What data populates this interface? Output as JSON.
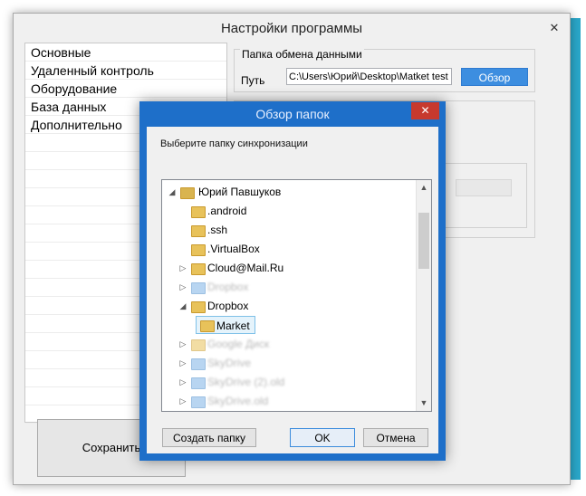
{
  "window": {
    "title": "Настройки программы",
    "close_glyph": "✕"
  },
  "menu": {
    "items": [
      "Основные",
      "Удаленный контроль",
      "Оборудование",
      "База данных",
      "Дополнительно"
    ]
  },
  "exchange": {
    "legend": "Папка обмена данными",
    "path_label": "Путь",
    "path_value": "C:\\Users\\Юрий\\Desktop\\Matket test",
    "browse_label": "Обзор"
  },
  "save_label": "Сохранить",
  "dialog": {
    "title": "Обзор папок",
    "close_glyph": "✕",
    "prompt": "Выберите папку синхронизации",
    "tree": [
      {
        "label": "Юрий Павшуков",
        "state": "expanded"
      },
      {
        "label": ".android"
      },
      {
        "label": ".ssh"
      },
      {
        "label": ".VirtualBox"
      },
      {
        "label": "Cloud@Mail.Ru",
        "state": "collapsed"
      },
      {
        "label": "Dropbox",
        "state": "collapsed",
        "obscured": true
      },
      {
        "label": "Dropbox",
        "state": "expanded"
      },
      {
        "label": "Market",
        "selected": true
      },
      {
        "label": "Google Диск",
        "state": "collapsed",
        "obscured": true
      },
      {
        "label": "SkyDrive",
        "state": "collapsed",
        "obscured": true
      },
      {
        "label": "SkyDrive (2).old",
        "state": "collapsed",
        "obscured": true
      },
      {
        "label": "SkyDrive.old",
        "state": "collapsed",
        "obscured": true
      }
    ],
    "buttons": {
      "new_folder": "Создать папку",
      "ok": "OK",
      "cancel": "Отмена"
    }
  },
  "colors": {
    "accent": "#1e6fc9",
    "browse_button": "#3d8ee0",
    "close_button": "#c7392e",
    "folder": "#e8c25a"
  },
  "icons": {
    "expanded": "expanded-arrow-icon",
    "collapsed": "collapsed-arrow-icon",
    "folder": "folder-icon",
    "user": "user-folder-icon"
  }
}
